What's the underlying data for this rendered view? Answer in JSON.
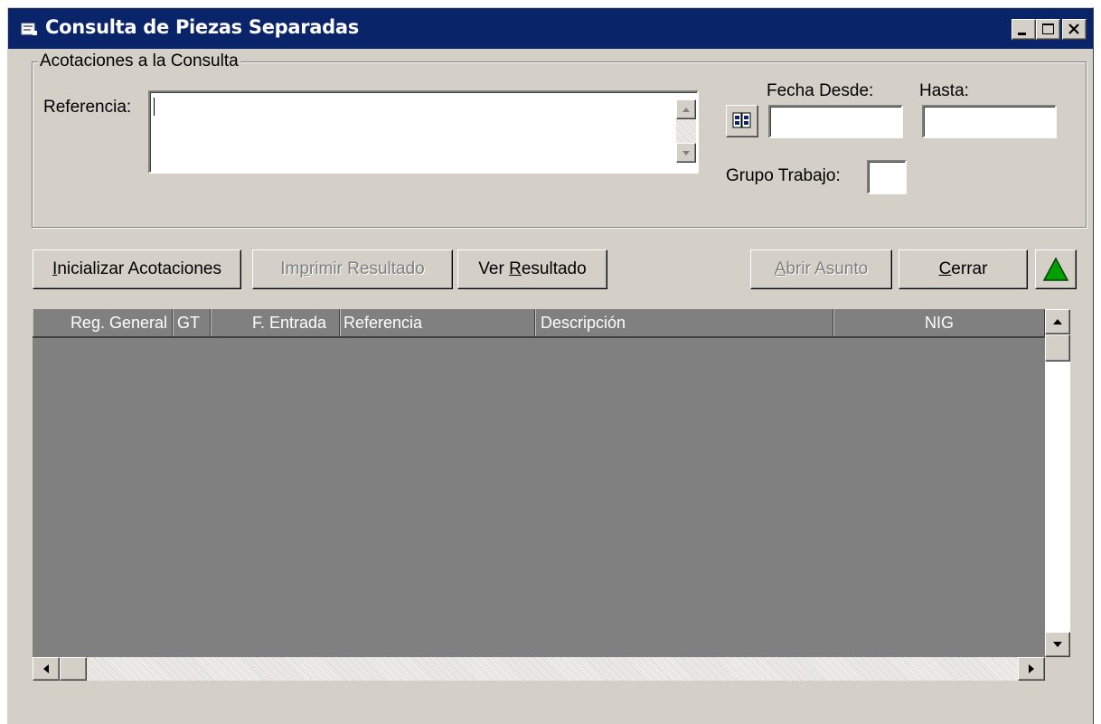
{
  "window": {
    "title": "Consulta de Piezas Separadas",
    "app_icon": "folder-app-icon",
    "controls": [
      "minimize-icon",
      "maximize-icon",
      "close-icon"
    ]
  },
  "filters": {
    "group_label": "Acotaciones a la Consulta",
    "referencia_label": "Referencia:",
    "referencia_value": "",
    "fecha_desde_label": "Fecha  Desde:",
    "hasta_label": "Hasta:",
    "fecha_desde_value": "",
    "hasta_value": "",
    "grupo_trabajo_label": "Grupo Trabajo:",
    "grupo_trabajo_value": "",
    "calendar_icon": "calendar-icon"
  },
  "toolbar": {
    "inicializar": {
      "label": "Inicializar Acotaciones",
      "underline": "I",
      "enabled": true
    },
    "imprimir": {
      "label": "Imprimir Resultado",
      "underline": "p",
      "enabled": false
    },
    "ver": {
      "label": "Ver Resultado",
      "underline": "R",
      "enabled": true
    },
    "abrir": {
      "label": "Abrir Asunto",
      "underline": "A",
      "enabled": false
    },
    "cerrar": {
      "label": "Cerrar",
      "underline": "C",
      "enabled": true
    },
    "up_icon": "green-triangle-up-icon"
  },
  "grid": {
    "columns": [
      "Reg. General",
      "GT",
      "F. Entrada",
      "Referencia",
      "Descripción",
      "NIG"
    ],
    "rows": []
  },
  "colors": {
    "titlebar": "#0a246a",
    "face": "#d4d0c8",
    "grid_bg": "#808080",
    "accent_green": "#00a000"
  }
}
